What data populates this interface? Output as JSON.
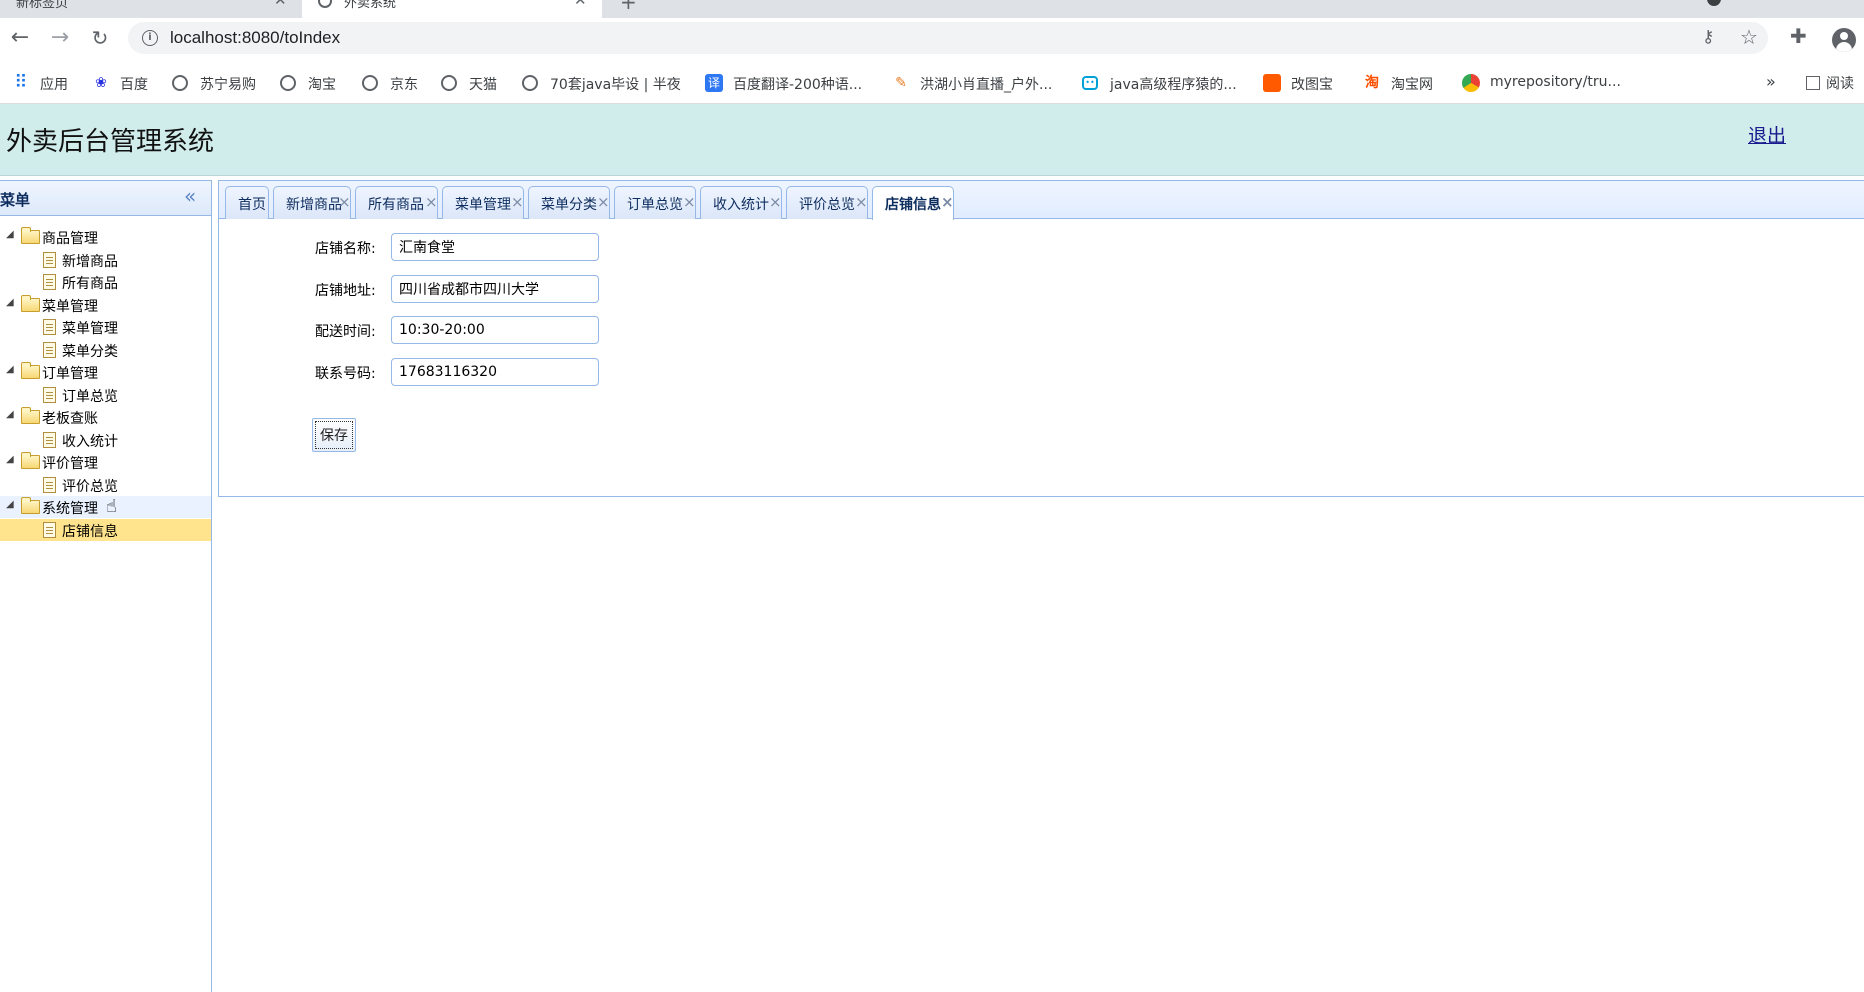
{
  "browser": {
    "tabs": [
      {
        "title": "新标签页"
      },
      {
        "title": "外卖系统"
      }
    ],
    "url": "localhost:8080/toIndex",
    "bookmarks": [
      {
        "label": "应用",
        "icon": "apps-icon"
      },
      {
        "label": "百度",
        "icon": "baidu-icon"
      },
      {
        "label": "苏宁易购",
        "icon": "globe-icon"
      },
      {
        "label": "淘宝",
        "icon": "globe-icon"
      },
      {
        "label": "京东",
        "icon": "globe-icon"
      },
      {
        "label": "天猫",
        "icon": "globe-icon"
      },
      {
        "label": "70套java毕设 | 半夜",
        "icon": "globe-icon"
      },
      {
        "label": "百度翻译-200种语...",
        "icon": "fanyi-icon"
      },
      {
        "label": "洪湖小肖直播_户外...",
        "icon": "huya-icon"
      },
      {
        "label": "java高级程序猿的...",
        "icon": "bilibili-icon"
      },
      {
        "label": "改图宝",
        "icon": "gaitubao-icon"
      },
      {
        "label": "淘宝网",
        "icon": "taobao-icon"
      },
      {
        "label": "myrepository/tru...",
        "icon": "chrome-icon"
      }
    ],
    "more": "»",
    "reading_list": "阅读"
  },
  "app": {
    "title": "外卖后台管理系统",
    "logout": "退出"
  },
  "sidebar": {
    "title": "菜单",
    "tree": [
      {
        "type": "folder",
        "label": "商品管理"
      },
      {
        "type": "leaf",
        "label": "新增商品"
      },
      {
        "type": "leaf",
        "label": "所有商品"
      },
      {
        "type": "folder",
        "label": "菜单管理"
      },
      {
        "type": "leaf",
        "label": "菜单管理"
      },
      {
        "type": "leaf",
        "label": "菜单分类"
      },
      {
        "type": "folder",
        "label": "订单管理"
      },
      {
        "type": "leaf",
        "label": "订单总览"
      },
      {
        "type": "folder",
        "label": "老板查账"
      },
      {
        "type": "leaf",
        "label": "收入统计"
      },
      {
        "type": "folder",
        "label": "评价管理"
      },
      {
        "type": "leaf",
        "label": "评价总览"
      },
      {
        "type": "folder",
        "label": "系统管理"
      },
      {
        "type": "leaf",
        "label": "店铺信息"
      }
    ],
    "selected": "店铺信息"
  },
  "tabs": [
    {
      "label": "首页",
      "closable": false
    },
    {
      "label": "新增商品",
      "closable": true
    },
    {
      "label": "所有商品",
      "closable": true
    },
    {
      "label": "菜单管理",
      "closable": true
    },
    {
      "label": "菜单分类",
      "closable": true
    },
    {
      "label": "订单总览",
      "closable": true
    },
    {
      "label": "收入统计",
      "closable": true
    },
    {
      "label": "评价总览",
      "closable": true
    },
    {
      "label": "店铺信息",
      "closable": true,
      "active": true
    }
  ],
  "form": {
    "shop_name_label": "店铺名称:",
    "shop_name_value": "汇南食堂",
    "address_label": "店铺地址:",
    "address_value": "四川省成都市四川大学",
    "delivery_time_label": "配送时间:",
    "delivery_time_value": "10:30-20:00",
    "phone_label": "联系号码:",
    "phone_value": "17683116320",
    "save_label": "保存"
  },
  "colors": {
    "header_bg": "#d0eceb",
    "panel_border": "#95b8e7",
    "selected_bg": "#ffe48d"
  }
}
